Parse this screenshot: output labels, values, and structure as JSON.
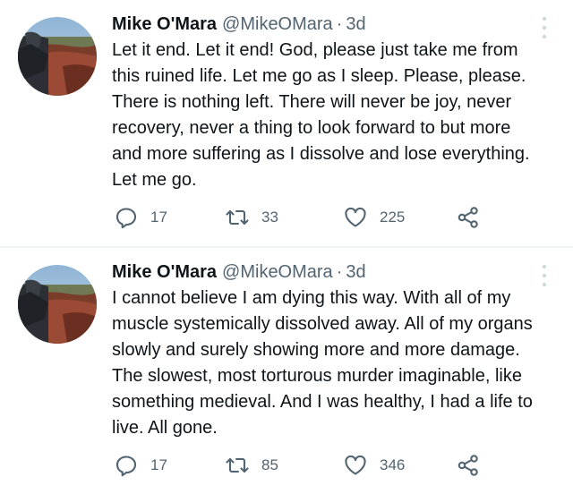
{
  "tweets": [
    {
      "author_name": "Mike O'Mara",
      "handle": "@MikeOMara",
      "separator": "·",
      "time": "3d",
      "text": "Let it end. Let it end! God, please just take me from\nthis ruined life. Let me go as I sleep. Please, please.\nThere is nothing left. There will never be joy, never\nrecovery, never a thing to look forward to but more\nand more suffering as I dissolve and lose everything.\nLet me go.",
      "replies": "17",
      "retweets": "33",
      "likes": "225",
      "icons": {
        "reply": "reply-icon",
        "retweet": "retweet-icon",
        "like": "heart-icon",
        "share": "share-icon",
        "more": "more-vertical-icon"
      }
    },
    {
      "author_name": "Mike O'Mara",
      "handle": "@MikeOMara",
      "separator": "·",
      "time": "3d",
      "text": "I cannot believe I am dying this way. With all of my\nmuscle systemically dissolved away. All of my organs\nslowly and surely showing more and more damage.\nThe slowest, most torturous murder imaginable, like\nsomething medieval. And I was healthy, I had a life to\nlive. All gone.",
      "replies": "17",
      "retweets": "85",
      "likes": "346",
      "icons": {
        "reply": "reply-icon",
        "retweet": "retweet-icon",
        "like": "heart-icon",
        "share": "share-icon",
        "more": "more-vertical-icon"
      }
    }
  ],
  "colors": {
    "text": "#0f1419",
    "secondary": "#536471",
    "divider": "#eff3f4",
    "background": "#ffffff"
  }
}
